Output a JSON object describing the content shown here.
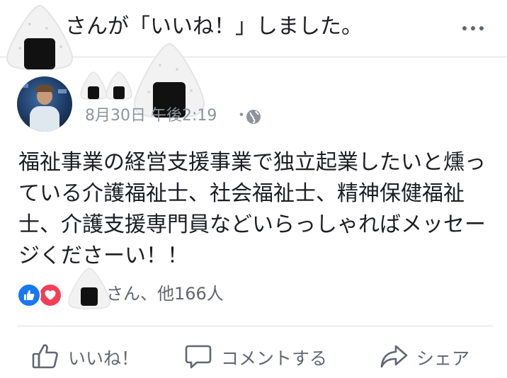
{
  "header": {
    "notification_text": "さんが「いいね！」しました。",
    "more_icon": "more-horizontal-icon"
  },
  "post": {
    "timestamp": "8月30日 午後2:19",
    "separator": "・",
    "audience_icon": "globe-icon",
    "body_lines": [
      "福祉事業の経営支援事業で独立起業したいと燻っ",
      "ている介護福祉士、社会福祉士、精神保健福祉",
      "士、介護支援専門員などいらっしゃればメッセー",
      "ジくださーい！！"
    ]
  },
  "reactions": {
    "icons": [
      "like-reaction-icon",
      "love-reaction-icon"
    ],
    "summary": "さん、他166人"
  },
  "actions": {
    "like_label": "いいね！",
    "comment_label": "コメントする",
    "share_label": "シェア"
  },
  "colors": {
    "like_blue": "#1877f2",
    "love_red": "#f33e58",
    "secondary_text": "#606770",
    "meta_text": "#8d949e",
    "divider": "#dadde1"
  }
}
